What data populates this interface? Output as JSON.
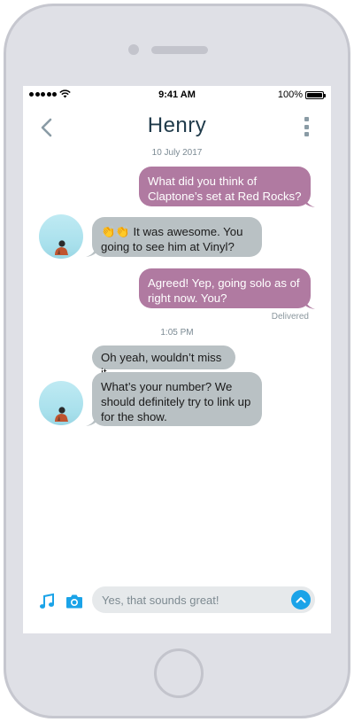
{
  "status_bar": {
    "time": "9:41 AM",
    "battery": "100%"
  },
  "header": {
    "contact_name": "Henry",
    "back_icon": "chevron-left-icon",
    "more_icon": "more-vertical-icon"
  },
  "conversation": {
    "date_label": "10 July 2017",
    "time_label": "1:05 PM",
    "messages": [
      {
        "direction": "outgoing",
        "lines": [
          "What did you think of",
          "Claptone’s set at Red Rocks?"
        ]
      },
      {
        "direction": "incoming",
        "emoji": "👏👏",
        "lines": [
          "It was awesome. You",
          "going to see him at Vinyl?"
        ]
      },
      {
        "direction": "outgoing",
        "lines": [
          "Agreed! Yep, going solo as of",
          "right now. You?"
        ]
      },
      {
        "direction": "incoming",
        "lines": [
          "Oh yeah, wouldn’t miss it."
        ]
      },
      {
        "direction": "incoming",
        "lines": [
          "What’s your number? We",
          "should definitely try to link up",
          "for the show."
        ]
      }
    ],
    "delivered_label": "Delivered"
  },
  "compose": {
    "input_value": "Yes, that sounds great!",
    "music_icon": "music-note-icon",
    "camera_icon": "camera-icon",
    "send_icon": "send-up-arrow-icon"
  },
  "colors": {
    "outgoing_bubble": "#b07aa1",
    "incoming_bubble": "#b9c1c4",
    "accent": "#1aa3e8",
    "name": "#1f3a4a"
  }
}
